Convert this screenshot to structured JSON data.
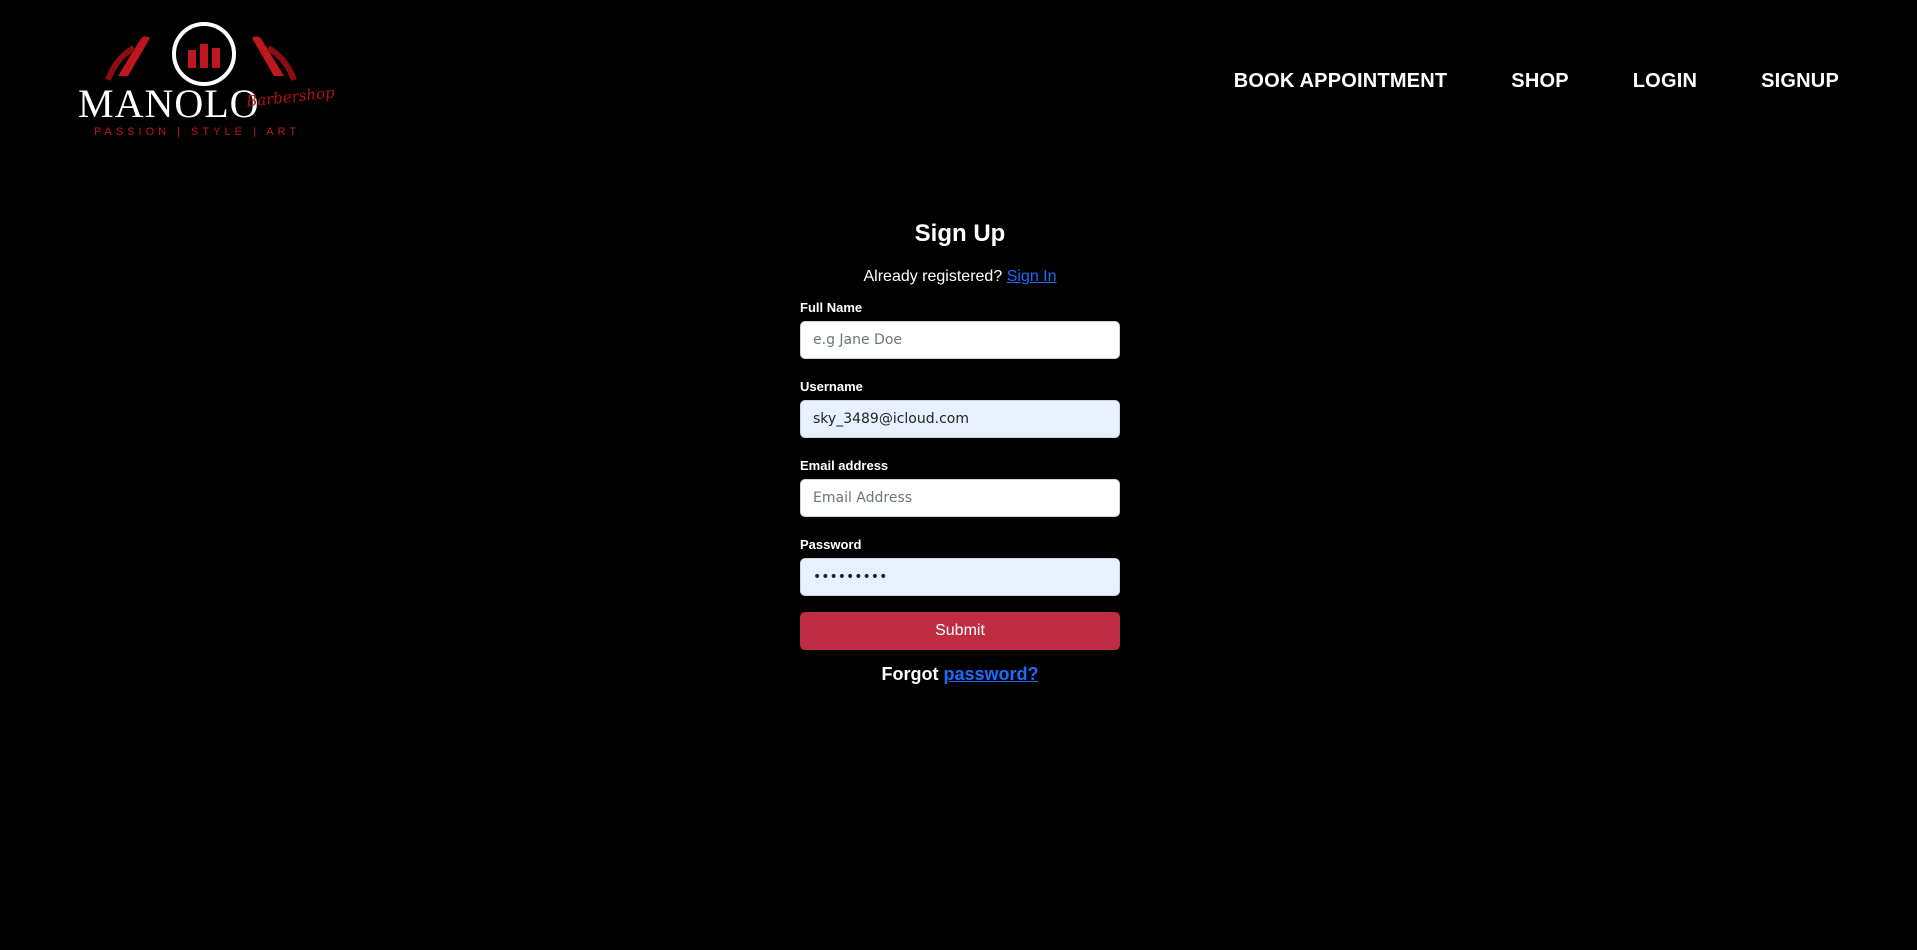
{
  "brand": {
    "wordmark": "MANOLO",
    "script": "Barbershop",
    "tagline": "PASSION | STYLE | ART",
    "accent_color": "#c0161f"
  },
  "nav": {
    "items": [
      {
        "label": "BOOK APPOINTMENT"
      },
      {
        "label": "SHOP"
      },
      {
        "label": "LOGIN"
      },
      {
        "label": "SIGNUP"
      }
    ]
  },
  "form": {
    "title": "Sign Up",
    "already_text": "Already registered?",
    "sign_in_link": "Sign In",
    "fields": {
      "full_name": {
        "label": "Full Name",
        "placeholder": "e.g Jane Doe",
        "value": ""
      },
      "username": {
        "label": "Username",
        "placeholder": "",
        "value": "sky_3489@icloud.com"
      },
      "email": {
        "label": "Email address",
        "placeholder": "Email Address",
        "value": ""
      },
      "password": {
        "label": "Password",
        "placeholder": "",
        "value": "•••••••••"
      }
    },
    "submit_label": "Submit",
    "submit_color": "#c02d42",
    "forgot_text": "Forgot",
    "forgot_link": "password?",
    "link_color": "#1e6bff"
  }
}
